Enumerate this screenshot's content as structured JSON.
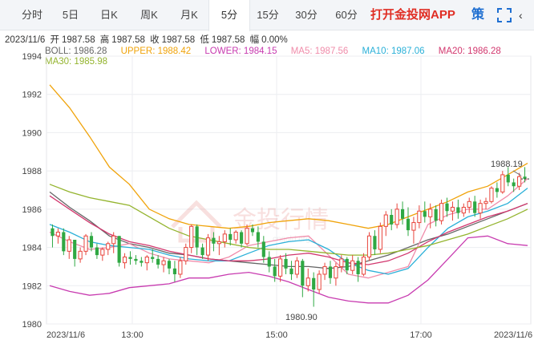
{
  "tabs": [
    {
      "label": "分时",
      "active": false
    },
    {
      "label": "5日",
      "active": false
    },
    {
      "label": "日K",
      "active": false
    },
    {
      "label": "周K",
      "active": false
    },
    {
      "label": "月K",
      "active": false
    },
    {
      "label": "5分",
      "active": true
    },
    {
      "label": "15分",
      "active": false
    },
    {
      "label": "30分",
      "active": false
    },
    {
      "label": "60分",
      "active": false
    }
  ],
  "promo_label": "打开金投网APP",
  "strategy_label": "策",
  "more_label": "‹",
  "icons": {
    "fullscreen": "fullscreen-icon"
  },
  "quote": {
    "date": "2023/11/6",
    "open_label": "开",
    "open": "1987.58",
    "high_label": "高",
    "high": "1987.58",
    "close_label": "收",
    "close": "1987.58",
    "low_label": "低",
    "low": "1987.58",
    "change_label": "幅",
    "change": "0.00%"
  },
  "indicators": {
    "boll": "BOLL: 1986.28",
    "upper": "UPPER: 1988.42",
    "lower": "LOWER: 1984.15",
    "ma5": "MA5: 1987.56",
    "ma10": "MA10: 1987.06",
    "ma20": "MA20: 1986.28",
    "ma30": "MA30: 1985.98"
  },
  "colors": {
    "up": "#e8453c",
    "down": "#2fa843",
    "boll": "#666666",
    "upper": "#f0a30a",
    "lower": "#c83bb0",
    "ma5": "#f08caa",
    "ma10": "#2ab0d8",
    "ma20": "#d2376e",
    "ma30": "#94b42e"
  },
  "watermark_text": "金投行情",
  "watermark_url": "cngold.org",
  "chart_data": {
    "type": "candlestick",
    "ylim": [
      1980,
      1994
    ],
    "yticks": [
      1980,
      1982,
      1984,
      1986,
      1988,
      1990,
      1992,
      1994
    ],
    "xtick_labels": [
      "2023/11/6",
      "13:00",
      "15:00",
      "17:00",
      "2023/11/6"
    ],
    "annotations": {
      "high": "1988.19",
      "low": "1980.90"
    },
    "candles": [
      [
        1985.0,
        1985.2,
        1984.0,
        1984.6
      ],
      [
        1984.6,
        1985.0,
        1984.2,
        1984.8
      ],
      [
        1984.8,
        1985.0,
        1983.6,
        1983.8
      ],
      [
        1983.8,
        1984.6,
        1983.4,
        1984.4
      ],
      [
        1984.4,
        1984.4,
        1983.0,
        1983.4
      ],
      [
        1983.4,
        1984.0,
        1983.2,
        1983.8
      ],
      [
        1983.8,
        1984.7,
        1983.6,
        1984.6
      ],
      [
        1984.6,
        1984.8,
        1983.8,
        1984.0
      ],
      [
        1984.0,
        1984.2,
        1983.4,
        1983.6
      ],
      [
        1983.6,
        1984.0,
        1983.3,
        1983.9
      ],
      [
        1983.9,
        1984.3,
        1983.6,
        1984.2
      ],
      [
        1984.2,
        1984.8,
        1983.7,
        1984.6
      ],
      [
        1984.6,
        1984.6,
        1983.0,
        1983.2
      ],
      [
        1983.2,
        1983.7,
        1982.9,
        1983.5
      ],
      [
        1983.5,
        1983.8,
        1983.1,
        1983.4
      ],
      [
        1983.4,
        1983.6,
        1983.1,
        1983.3
      ],
      [
        1983.3,
        1983.5,
        1983.0,
        1983.2
      ],
      [
        1983.2,
        1983.6,
        1982.8,
        1983.5
      ],
      [
        1983.5,
        1983.9,
        1983.2,
        1983.4
      ],
      [
        1983.4,
        1983.6,
        1982.9,
        1983.1
      ],
      [
        1983.1,
        1983.5,
        1982.7,
        1983.3
      ],
      [
        1983.3,
        1983.4,
        1982.6,
        1982.9
      ],
      [
        1982.9,
        1983.3,
        1982.2,
        1982.6
      ],
      [
        1982.6,
        1983.5,
        1982.4,
        1983.3
      ],
      [
        1983.3,
        1984.2,
        1983.1,
        1984.0
      ],
      [
        1984.0,
        1985.2,
        1983.7,
        1985.1
      ],
      [
        1985.1,
        1985.2,
        1983.6,
        1984.0
      ],
      [
        1984.0,
        1984.2,
        1983.4,
        1983.6
      ],
      [
        1983.6,
        1984.7,
        1983.3,
        1984.5
      ],
      [
        1984.5,
        1984.8,
        1983.8,
        1984.2
      ],
      [
        1984.2,
        1984.6,
        1983.6,
        1984.3
      ],
      [
        1984.3,
        1984.9,
        1984.0,
        1984.7
      ],
      [
        1984.7,
        1985.0,
        1984.1,
        1984.4
      ],
      [
        1984.4,
        1984.9,
        1984.2,
        1984.8
      ],
      [
        1984.8,
        1984.9,
        1984.0,
        1984.2
      ],
      [
        1984.2,
        1985.2,
        1984.1,
        1985.0
      ],
      [
        1985.0,
        1985.2,
        1984.6,
        1984.8
      ],
      [
        1984.8,
        1985.1,
        1984.0,
        1984.3
      ],
      [
        1984.3,
        1984.6,
        1983.2,
        1983.5
      ],
      [
        1983.5,
        1983.8,
        1982.7,
        1983.0
      ],
      [
        1983.0,
        1983.4,
        1982.2,
        1982.5
      ],
      [
        1982.5,
        1983.6,
        1982.2,
        1983.4
      ],
      [
        1983.4,
        1983.7,
        1982.6,
        1982.9
      ],
      [
        1982.9,
        1983.3,
        1982.3,
        1982.6
      ],
      [
        1982.6,
        1983.5,
        1982.4,
        1983.3
      ],
      [
        1983.3,
        1983.4,
        1981.4,
        1982.0
      ],
      [
        1982.0,
        1982.9,
        1981.7,
        1982.4
      ],
      [
        1982.4,
        1982.7,
        1980.9,
        1981.8
      ],
      [
        1981.8,
        1982.8,
        1981.6,
        1982.6
      ],
      [
        1982.6,
        1983.2,
        1982.3,
        1983.0
      ],
      [
        1983.0,
        1983.3,
        1982.1,
        1982.4
      ],
      [
        1982.4,
        1983.2,
        1982.0,
        1983.0
      ],
      [
        1983.0,
        1983.6,
        1982.7,
        1983.4
      ],
      [
        1983.4,
        1983.5,
        1982.6,
        1982.8
      ],
      [
        1982.8,
        1983.6,
        1982.6,
        1983.3
      ],
      [
        1983.3,
        1983.5,
        1982.2,
        1982.6
      ],
      [
        1982.6,
        1983.7,
        1982.5,
        1983.5
      ],
      [
        1983.5,
        1984.8,
        1983.3,
        1984.6
      ],
      [
        1984.6,
        1984.9,
        1983.6,
        1983.9
      ],
      [
        1983.9,
        1985.3,
        1983.7,
        1985.1
      ],
      [
        1985.1,
        1985.9,
        1984.6,
        1985.7
      ],
      [
        1985.7,
        1986.0,
        1984.9,
        1985.2
      ],
      [
        1985.2,
        1986.3,
        1985.0,
        1986.0
      ],
      [
        1986.0,
        1986.4,
        1985.2,
        1985.5
      ],
      [
        1985.5,
        1986.1,
        1984.6,
        1984.9
      ],
      [
        1984.9,
        1985.6,
        1984.2,
        1985.3
      ],
      [
        1985.3,
        1986.2,
        1985.0,
        1985.9
      ],
      [
        1985.9,
        1986.4,
        1985.3,
        1985.6
      ],
      [
        1985.6,
        1986.3,
        1985.0,
        1986.0
      ],
      [
        1986.0,
        1986.2,
        1985.1,
        1985.4
      ],
      [
        1985.4,
        1986.5,
        1985.2,
        1986.3
      ],
      [
        1986.3,
        1986.6,
        1985.6,
        1985.9
      ],
      [
        1985.9,
        1986.4,
        1985.4,
        1986.1
      ],
      [
        1986.1,
        1986.5,
        1985.5,
        1985.8
      ],
      [
        1985.8,
        1986.3,
        1985.6,
        1986.1
      ],
      [
        1986.1,
        1986.6,
        1985.8,
        1986.4
      ],
      [
        1986.4,
        1986.7,
        1985.6,
        1985.8
      ],
      [
        1985.8,
        1986.5,
        1985.5,
        1986.3
      ],
      [
        1986.3,
        1986.6,
        1986.0,
        1986.4
      ],
      [
        1986.4,
        1987.2,
        1986.3,
        1987.1
      ],
      [
        1987.1,
        1987.4,
        1986.6,
        1986.9
      ],
      [
        1986.9,
        1988.0,
        1986.8,
        1987.8
      ],
      [
        1987.8,
        1988.2,
        1987.2,
        1987.4
      ],
      [
        1987.4,
        1987.6,
        1986.9,
        1987.2
      ],
      [
        1987.2,
        1987.9,
        1987.0,
        1987.7
      ],
      [
        1987.7,
        1988.2,
        1987.4,
        1987.58
      ]
    ],
    "series": [
      {
        "name": "UPPER",
        "values": [
          1992.5,
          1991.3,
          1989.8,
          1988.2,
          1987.3,
          1986.0,
          1985.5,
          1985.2,
          1985.1,
          1985.0,
          1985.1,
          1985.3,
          1985.4,
          1985.5,
          1985.4,
          1985.2,
          1985.0,
          1985.2,
          1985.6,
          1986.0,
          1986.4,
          1986.9,
          1987.2,
          1987.8,
          1988.4
        ]
      },
      {
        "name": "BOLL",
        "values": [
          1986.9,
          1986.1,
          1985.4,
          1984.6,
          1984.2,
          1984.0,
          1983.7,
          1983.6,
          1983.4,
          1983.3,
          1983.2,
          1983.1,
          1983.0,
          1983.0,
          1982.9,
          1983.0,
          1983.3,
          1983.6,
          1984.0,
          1984.4,
          1984.7,
          1985.1,
          1985.5,
          1985.9,
          1986.3
        ]
      },
      {
        "name": "LOWER",
        "values": [
          1982.0,
          1981.7,
          1981.5,
          1981.6,
          1981.9,
          1982.0,
          1982.1,
          1982.4,
          1982.4,
          1982.6,
          1982.7,
          1982.5,
          1982.2,
          1981.8,
          1981.4,
          1981.2,
          1981.1,
          1981.1,
          1981.5,
          1982.3,
          1983.4,
          1984.5,
          1984.6,
          1984.2,
          1984.1
        ]
      },
      {
        "name": "MA5",
        "values": [
          1984.8,
          1984.3,
          1983.9,
          1984.0,
          1984.2,
          1983.7,
          1983.4,
          1983.3,
          1983.2,
          1983.5,
          1984.1,
          1984.3,
          1984.5,
          1984.6,
          1983.6,
          1982.6,
          1982.4,
          1982.7,
          1983.0,
          1985.2,
          1985.7,
          1986.0,
          1986.0,
          1986.7,
          1987.6
        ]
      },
      {
        "name": "MA10",
        "values": [
          1985.2,
          1984.8,
          1984.3,
          1984.1,
          1984.0,
          1983.9,
          1983.6,
          1983.4,
          1983.3,
          1983.3,
          1983.7,
          1984.1,
          1984.3,
          1984.4,
          1983.9,
          1983.2,
          1982.8,
          1982.6,
          1982.9,
          1984.0,
          1985.0,
          1985.6,
          1985.9,
          1986.3,
          1987.1
        ]
      },
      {
        "name": "MA20",
        "values": [
          1986.7,
          1986.0,
          1985.3,
          1984.7,
          1984.3,
          1984.1,
          1983.8,
          1983.6,
          1983.4,
          1983.3,
          1983.3,
          1983.4,
          1983.6,
          1983.7,
          1983.5,
          1983.2,
          1983.1,
          1983.3,
          1983.7,
          1984.3,
          1984.8,
          1985.2,
          1985.6,
          1985.9,
          1986.3
        ]
      },
      {
        "name": "MA30",
        "values": [
          1987.3,
          1986.9,
          1986.6,
          1986.4,
          1986.2,
          1985.6,
          1985.0,
          1984.6,
          1984.4,
          1984.2,
          1984.0,
          1983.9,
          1983.9,
          1983.8,
          1983.7,
          1983.6,
          1983.6,
          1983.7,
          1983.9,
          1984.1,
          1984.4,
          1984.7,
          1985.1,
          1985.5,
          1986.0
        ]
      }
    ]
  }
}
